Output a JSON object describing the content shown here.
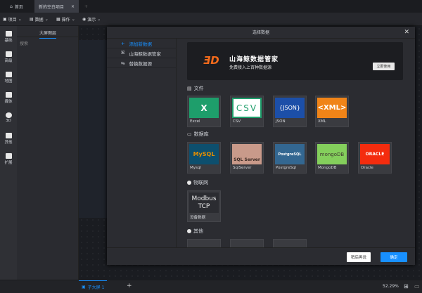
{
  "tabs": [
    {
      "label": "首页",
      "icon": "home-icon"
    },
    {
      "label": "新的空白项目",
      "active": true
    }
  ],
  "toolbar": [
    "项目",
    "数据",
    "操作",
    "演示"
  ],
  "rail": [
    "基础",
    "高级",
    "地图",
    "媒体",
    "3D",
    "其他",
    "扩展"
  ],
  "layers": {
    "title": "大屏图层",
    "search_placeholder": "搜索"
  },
  "modal": {
    "title": "选择数据",
    "nav": [
      {
        "label": "添加新数据",
        "active": true
      },
      {
        "label": "山海鲸数据管家"
      },
      {
        "label": "替换数据源"
      }
    ],
    "banner": {
      "title": "山海鲸数据管家",
      "subtitle": "免费接入上百种数据源",
      "button": "立即使用"
    },
    "sections": [
      {
        "title": "文件",
        "items": [
          {
            "label": "Excel",
            "logo": "X",
            "bg": "#1e9e6b"
          },
          {
            "label": "CSV",
            "logo": "CSV",
            "bg": "#ffffff"
          },
          {
            "label": "JSON",
            "logo": "{JSON}",
            "bg": "#1c4fa8"
          },
          {
            "label": "XML",
            "logo": "<XML>",
            "bg": "#f08418"
          }
        ]
      },
      {
        "title": "数据库",
        "items": [
          {
            "label": "Mysql",
            "logo": "MySQL",
            "bg": "#0d4f6e"
          },
          {
            "label": "SqlServer",
            "logo": "SQL Server",
            "bg": "#c99a8a"
          },
          {
            "label": "PostgreSql",
            "logo": "PostgreSQL",
            "bg": "#336791"
          },
          {
            "label": "MongoDB",
            "logo": "mongoDB",
            "bg": "#84cf5c"
          },
          {
            "label": "Oracle",
            "logo": "ORACLE",
            "bg": "#f42c0e"
          }
        ]
      },
      {
        "title": "物联网",
        "items": [
          {
            "label": "设备数据",
            "logo": "Modbus TCP",
            "bg": "#2b2c31"
          }
        ]
      },
      {
        "title": "其他",
        "items": []
      }
    ],
    "cancel": "稍后再说",
    "confirm": "确定"
  },
  "bottom": {
    "page_tab": "子大屏 1",
    "zoom": "52.29%"
  },
  "colors": {
    "accent": "#1890ff"
  }
}
